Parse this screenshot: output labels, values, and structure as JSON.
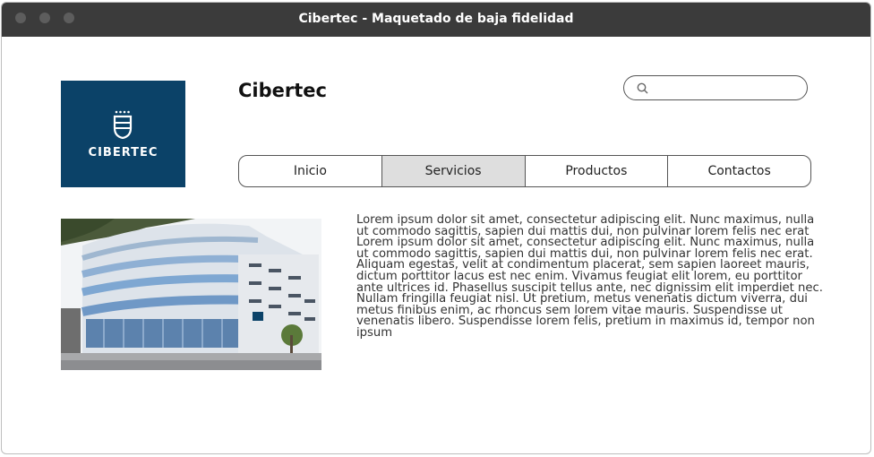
{
  "window": {
    "title": "Cibertec - Maquetado de baja fidelidad"
  },
  "logo": {
    "text": "CIBERTEC",
    "icon": "cibertec-shield-icon",
    "background": "#0b4268"
  },
  "header": {
    "brand": "Cibertec"
  },
  "search": {
    "placeholder": "",
    "value": "",
    "icon": "search-icon"
  },
  "nav": {
    "items": [
      {
        "label": "Inicio",
        "active": false
      },
      {
        "label": "Servicios",
        "active": true
      },
      {
        "label": "Productos",
        "active": false
      },
      {
        "label": "Contactos",
        "active": false
      }
    ]
  },
  "main": {
    "image": "cibertec-building-photo",
    "paragraph": "Lorem ipsum dolor sit amet, consectetur adipiscing elit. Nunc maximus, nulla ut commodo sagittis, sapien dui mattis dui, non pulvinar lorem felis nec erat Lorem ipsum dolor sit amet, consectetur adipiscing elit. Nunc maximus, nulla ut commodo sagittis, sapien dui mattis dui, non pulvinar lorem felis nec erat. Aliquam egestas, velit at condimentum placerat, sem sapien laoreet mauris, dictum porttitor lacus est nec enim. Vivamus feugiat elit lorem, eu porttitor ante ultrices id. Phasellus suscipit tellus ante, nec dignissim elit imperdiet nec. Nullam fringilla feugiat nisl. Ut pretium, metus venenatis dictum viverra, dui metus finibus enim, ac rhoncus sem lorem vitae mauris. Suspendisse ut venenatis libero. Suspendisse lorem felis, pretium in maximus id, tempor non ipsum"
  }
}
